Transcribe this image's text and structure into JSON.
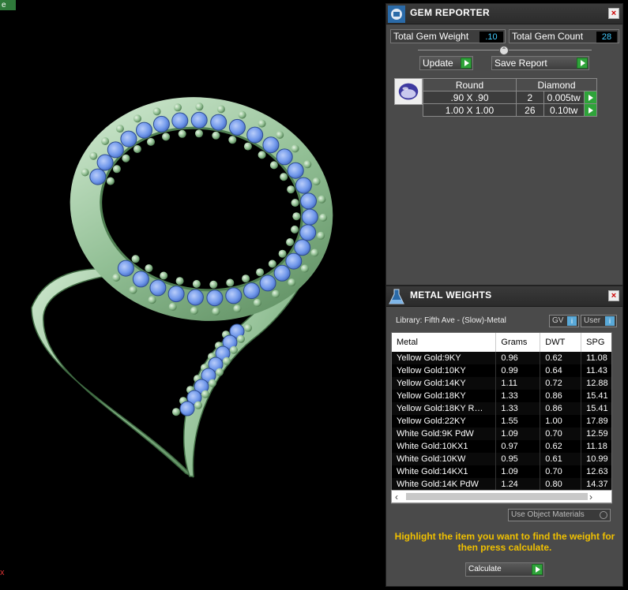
{
  "viewport": {
    "corner_tag": "e",
    "axis_label": "x"
  },
  "gem_reporter": {
    "title": "GEM REPORTER",
    "close_label": "×",
    "total_weight_label": "Total Gem Weight",
    "total_weight_value": ".10",
    "total_count_label": "Total Gem Count",
    "total_count_value": "28",
    "update_label": "Update",
    "save_report_label": "Save Report",
    "table": {
      "headers": [
        "Round",
        "Diamond"
      ],
      "rows": [
        {
          "size": ".90 X .90",
          "count": "2",
          "weight": "0.005tw"
        },
        {
          "size": "1.00 X 1.00",
          "count": "26",
          "weight": "0.10tw"
        }
      ]
    }
  },
  "metal_weights": {
    "title": "METAL WEIGHTS",
    "close_label": "×",
    "library_label": "Library: Fifth Ave - (Slow)-Metal",
    "gv_label": "GV",
    "user_label": "User",
    "columns": [
      "Metal",
      "Grams",
      "DWT",
      "SPG"
    ],
    "rows": [
      [
        "Yellow Gold:9KY",
        "0.96",
        "0.62",
        "11.08"
      ],
      [
        "Yellow Gold:10KY",
        "0.99",
        "0.64",
        "11.43"
      ],
      [
        "Yellow Gold:14KY",
        "1.11",
        "0.72",
        "12.88"
      ],
      [
        "Yellow Gold:18KY",
        "1.33",
        "0.86",
        "15.41"
      ],
      [
        "Yellow Gold:18KY R…",
        "1.33",
        "0.86",
        "15.41"
      ],
      [
        "Yellow Gold:22KY",
        "1.55",
        "1.00",
        "17.89"
      ],
      [
        "White Gold:9K PdW",
        "1.09",
        "0.70",
        "12.59"
      ],
      [
        "White Gold:10KX1",
        "0.97",
        "0.62",
        "11.18"
      ],
      [
        "White Gold:10KW",
        "0.95",
        "0.61",
        "10.99"
      ],
      [
        "White Gold:14KX1",
        "1.09",
        "0.70",
        "12.63"
      ],
      [
        "White Gold:14K PdW",
        "1.24",
        "0.80",
        "14.37"
      ]
    ],
    "use_object_materials_label": "Use Object Materials",
    "hint": "Highlight the item you want to find the weight for then press calculate.",
    "calculate_label": "Calculate"
  },
  "colors": {
    "metal": "#9ec9a0",
    "gem": "#6f97ea",
    "accent_green": "#2fa33a",
    "value_blue": "#44ccff",
    "hint_yellow": "#f0c000"
  }
}
